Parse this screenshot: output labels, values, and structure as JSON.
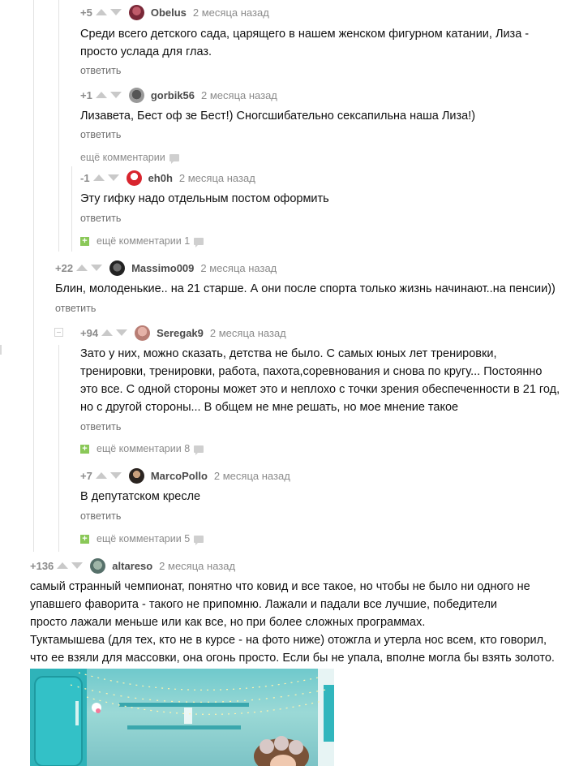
{
  "comments": [
    {
      "rating": "+5",
      "author": "Obelus",
      "time": "2 месяца назад",
      "text": "Среди всего детского сада, царящего в нашем женском фигурном катании, Лиза - просто услада для глаз.",
      "reply": "ответить"
    },
    {
      "rating": "+1",
      "author": "gorbik56",
      "time": "2 месяца назад",
      "text": "Лизавета, Бест оф зе Бест!) Сногсшибательно сексапильна наша Лиза!)",
      "reply": "ответить"
    },
    {
      "rating": "-1",
      "author": "eh0h",
      "time": "2 месяца назад",
      "text": "Эту гифку надо отдельным постом оформить",
      "reply": "ответить"
    },
    {
      "rating": "+22",
      "author": "Massimo009",
      "time": "2 месяца назад",
      "text": "Блин, молоденькие.. на 21 старше. А они после спорта только жизнь начинают..на пенсии))",
      "reply": "ответить"
    },
    {
      "rating": "+94",
      "author": "Seregak9",
      "time": "2 месяца назад",
      "text": "Зато у них, можно сказать, детства не было. С самых юных лет тренировки, тренировки, тренировки, работа, пахота,соревнования и снова по кругу... Постоянно это все. С одной стороны может это и неплохо с точки зрения обеспеченности в 21 год, но с другой стороны... В общем не мне решать, но мое мнение такое",
      "reply": "ответить"
    },
    {
      "rating": "+7",
      "author": "MarcoPollo",
      "time": "2 месяца назад",
      "text": "В депутатском кресле",
      "reply": "ответить"
    },
    {
      "rating": "+136",
      "author": "altareso",
      "time": "2 месяца назад",
      "text": "самый странный чемпионат, понятно что ковид и все такое, но чтобы не было ни одного не упавшего фаворита - такого не припомню. Лажали и падали все лучшие, победители просто лажали меньше или как все, но при более сложных программах.",
      "text2": "Туктамышева (для тех, кто не в курсе - на фото ниже) отожгла и утерла нос всем, кто говорил, что ее взяли для массовки, она огонь просто. Если бы не упала, вполне могла бы взять золото."
    }
  ],
  "more_links": {
    "plain": "ещё комментарии",
    "after_eh0h": "ещё комментарии 1",
    "after_seregak9": "ещё комментарии 8",
    "after_marcopollo": "ещё комментарии 5"
  },
  "colors": {
    "accent_green": "#8ac858",
    "muted": "#8b8b8b",
    "thread_line": "#e3e3e3"
  }
}
